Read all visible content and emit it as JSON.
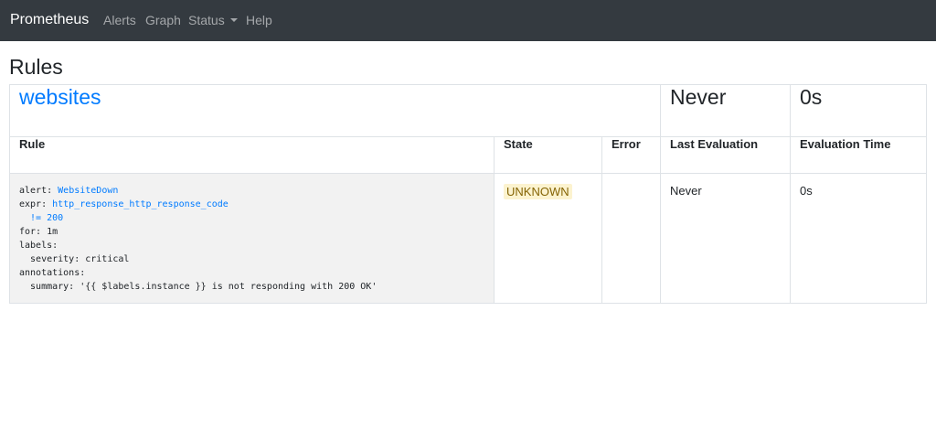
{
  "navbar": {
    "brand": "Prometheus",
    "links": [
      "Alerts",
      "Graph",
      "Status",
      "Help"
    ]
  },
  "page": {
    "title": "Rules"
  },
  "group": {
    "name": "websites",
    "last_evaluation": "Never",
    "evaluation_time": "0s"
  },
  "table": {
    "headers": [
      "Rule",
      "State",
      "Error",
      "Last Evaluation",
      "Evaluation Time"
    ]
  },
  "rule": {
    "alert_key": "alert: ",
    "alert_name": "WebsiteDown",
    "expr_key": "expr: ",
    "expr_line1": "http_response_http_response_code",
    "expr_line2": "  != 200",
    "for_line": "for: 1m",
    "labels_line": "labels:",
    "severity_line": "  severity: critical",
    "annotations_line": "annotations:",
    "summary_line": "  summary: '{{ $labels.instance }} is not responding with 200 OK'",
    "state": "UNKNOWN",
    "error": "",
    "last_evaluation": "Never",
    "evaluation_time": "0s"
  },
  "colors": {
    "navbar_bg": "#343a40",
    "link": "#007bff",
    "badge_bg": "#fcf3cf",
    "rule_bg": "#f2f2f2"
  }
}
